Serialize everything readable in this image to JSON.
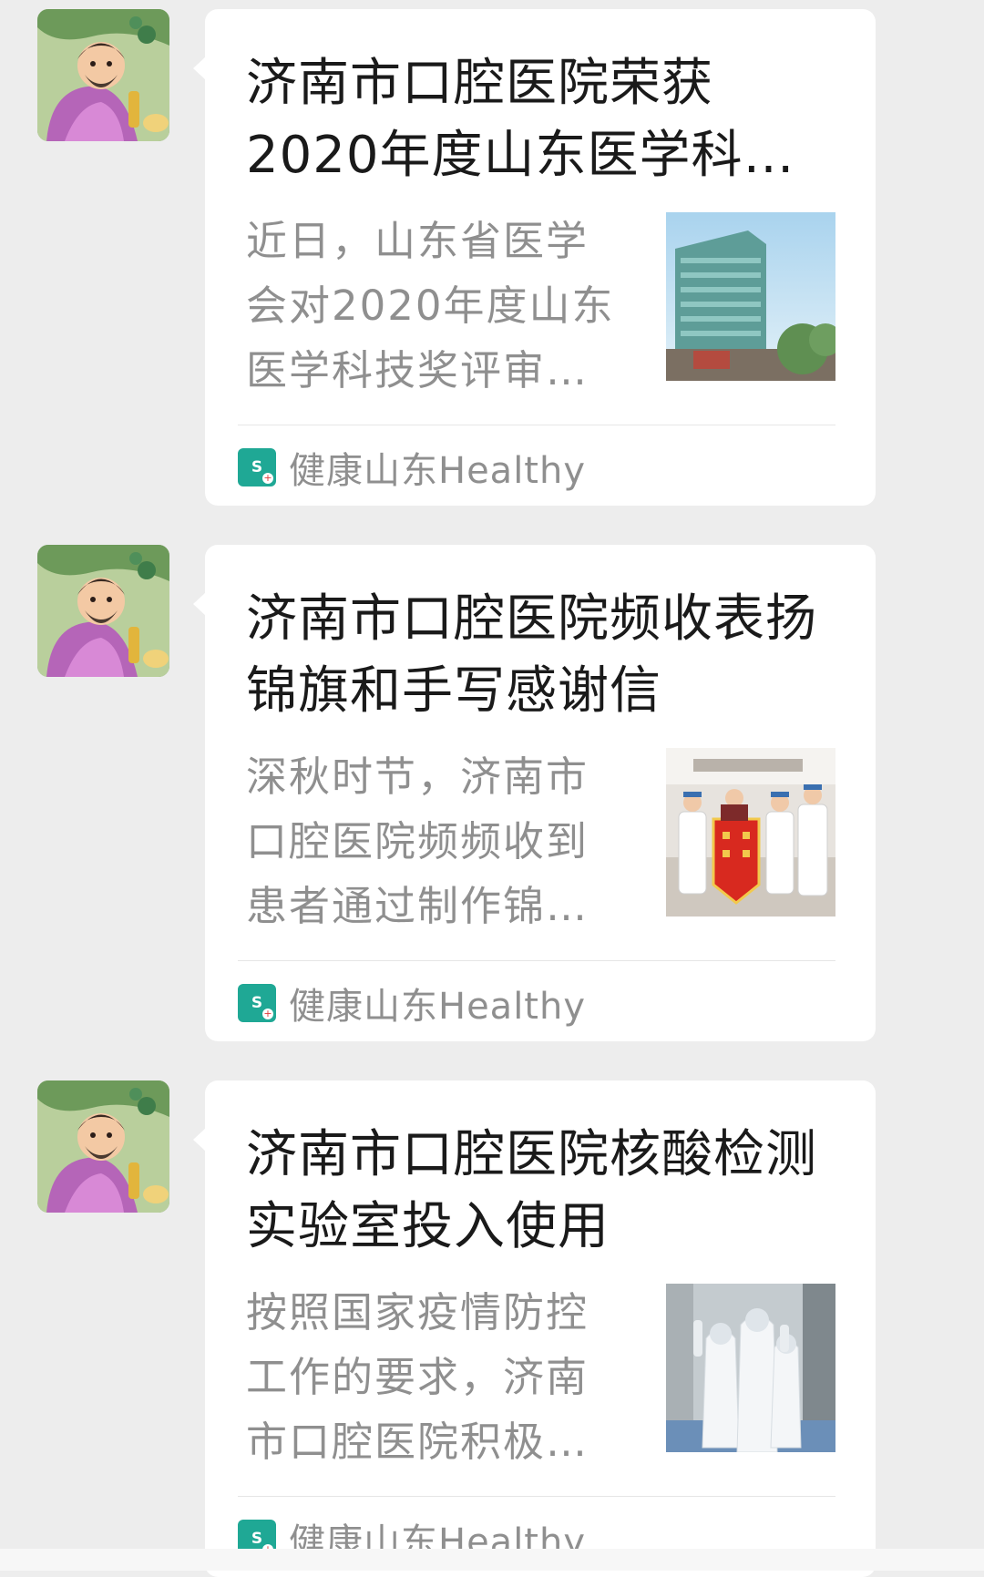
{
  "feed": {
    "messages": [
      {
        "title": "济南市口腔医院荣获2020年度山东医学科…",
        "description": "近日，山东省医学会对2020年度山东医学科技奖评审…",
        "source": "健康山东Healthy",
        "thumbnail": "hospital-building-photo"
      },
      {
        "title": "济南市口腔医院频收表扬锦旗和手写感谢信",
        "description": "深秋时节，济南市口腔医院频频收到患者通过制作锦…",
        "source": "健康山东Healthy",
        "thumbnail": "staff-with-banner-photo"
      },
      {
        "title": "济南市口腔医院核酸检测实验室投入使用",
        "description": "按照国家疫情防控工作的要求，济南市口腔医院积极…",
        "source": "健康山东Healthy",
        "thumbnail": "protective-suits-photo"
      }
    ]
  },
  "colors": {
    "background": "#ededed",
    "card": "#ffffff",
    "source_icon": "#1fa895",
    "title_text": "#1a1a1a",
    "secondary_text": "#8f8f8f"
  }
}
